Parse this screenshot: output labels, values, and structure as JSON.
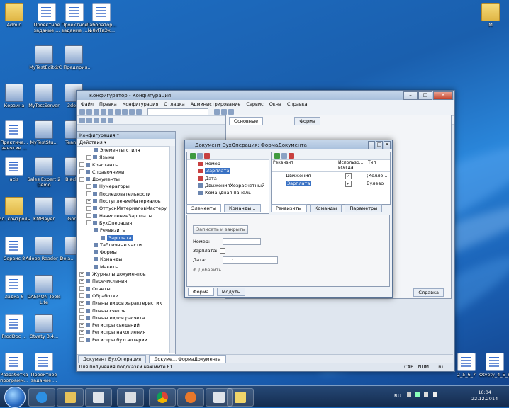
{
  "desktop": {
    "icons": [
      {
        "label": "Admin",
        "kind": "folder"
      },
      {
        "label": "Проектное задание ...",
        "kind": "doc"
      },
      {
        "label": "Проектное задание ...",
        "kind": "doc"
      },
      {
        "label": "Лаборатор... №8ИТвЭк...",
        "kind": "doc"
      },
      {
        "label": "MyTestEditor",
        "kind": "app"
      },
      {
        "label": "1С Предприя...",
        "kind": "app"
      },
      {
        "label": "Корзина",
        "kind": "app"
      },
      {
        "label": "MyTestServer",
        "kind": "app"
      },
      {
        "label": "3do...",
        "kind": "app"
      },
      {
        "label": "Практиче... занятие ...",
        "kind": "doc"
      },
      {
        "label": "MyTestStu...",
        "kind": "app"
      },
      {
        "label": "Team...",
        "kind": "app"
      },
      {
        "label": "acis",
        "kind": "doc"
      },
      {
        "label": "Sales Expert 2 Demo",
        "kind": "app"
      },
      {
        "label": "Black...",
        "kind": "app"
      },
      {
        "label": "Эл. контроль",
        "kind": "folder"
      },
      {
        "label": "KMPlayer",
        "kind": "app"
      },
      {
        "label": "Gor...",
        "kind": "app"
      },
      {
        "label": "Сервис 8",
        "kind": "doc"
      },
      {
        "label": "Adobe Reader 9",
        "kind": "app"
      },
      {
        "label": "Dela... Tools",
        "kind": "app"
      },
      {
        "label": "ладка 6",
        "kind": "doc"
      },
      {
        "label": "DAEMON Tools Lite",
        "kind": "app"
      },
      {
        "label": "ProdDoc ...",
        "kind": "doc"
      },
      {
        "label": "Otvety 3,4...",
        "kind": "app"
      },
      {
        "label": "Разработка программ...",
        "kind": "doc"
      },
      {
        "label": "Проектное задание ...",
        "kind": "doc"
      },
      {
        "label": "М",
        "kind": "folder"
      },
      {
        "label": "2_5_6_7",
        "kind": "doc"
      },
      {
        "label": "Otvety_4_5_6",
        "kind": "doc"
      }
    ]
  },
  "configurator": {
    "title": "Конфигуратор - Конфигурация",
    "menu": [
      "Файл",
      "Правка",
      "Конфигурация",
      "Отладка",
      "Администрирование",
      "Сервис",
      "Окна",
      "Справка"
    ],
    "tree_panel": {
      "title": "Конфигурация *",
      "actions_label": "Действия ▾",
      "items": [
        {
          "label": "Элементы стиля",
          "indent": 2
        },
        {
          "label": "Языки",
          "indent": 1
        },
        {
          "label": "Константы",
          "indent": 0
        },
        {
          "label": "Справочники",
          "indent": 0
        },
        {
          "label": "Документы",
          "indent": 0
        },
        {
          "label": "Нумераторы",
          "indent": 1
        },
        {
          "label": "Последовательности",
          "indent": 1
        },
        {
          "label": "ПоступлениеМатериалов",
          "indent": 1
        },
        {
          "label": "ОтпускМатериаловМастеру",
          "indent": 1
        },
        {
          "label": "НачислениеЗарплаты",
          "indent": 1
        },
        {
          "label": "БухОперация",
          "indent": 1
        },
        {
          "label": "Реквизиты",
          "indent": 2
        },
        {
          "label": "Зарплата",
          "indent": 3,
          "selected": true
        },
        {
          "label": "Табличные части",
          "indent": 2
        },
        {
          "label": "Формы",
          "indent": 2
        },
        {
          "label": "Команды",
          "indent": 2
        },
        {
          "label": "Макеты",
          "indent": 2
        },
        {
          "label": "Журналы документов",
          "indent": 0
        },
        {
          "label": "Перечисления",
          "indent": 0
        },
        {
          "label": "Отчеты",
          "indent": 0
        },
        {
          "label": "Обработки",
          "indent": 0
        },
        {
          "label": "Планы видов характеристик",
          "indent": 0
        },
        {
          "label": "Планы счетов",
          "indent": 0
        },
        {
          "label": "Планы видов расчета",
          "indent": 0
        },
        {
          "label": "Регистры сведений",
          "indent": 0
        },
        {
          "label": "Регистры накопления",
          "indent": 0
        },
        {
          "label": "Регистры бухгалтерии",
          "indent": 0
        }
      ]
    },
    "bg_tabs": [
      "Основные",
      "Форма"
    ],
    "bg_help": "Справка",
    "window_tabs": [
      "Документ БухОперация",
      "Докуме... ФормаДокумента"
    ],
    "status_text": "Для получения подсказки нажмите F1",
    "status_cap": "CAP",
    "status_num": "NUM",
    "status_lang": "ru"
  },
  "form_window": {
    "title": "Документ БухОперация: ФормаДокумента",
    "elements": [
      {
        "label": "Номер"
      },
      {
        "label": "Зарплата",
        "selected": true
      },
      {
        "label": "Дата"
      },
      {
        "label": "ДвиженияХозрасчетный"
      },
      {
        "label": "Командная панель"
      }
    ],
    "left_tabs": [
      "Элементы",
      "Команды..."
    ],
    "attr_headers": {
      "col1": "Реквизит",
      "col2": "Использо... всегда",
      "col3": "Тип"
    },
    "attr_rows": [
      {
        "name": "Движения",
        "type": "(Колле..."
      },
      {
        "name": "Зарплата",
        "type": "Булево",
        "selected": true
      }
    ],
    "right_tabs": [
      "Реквизиты",
      "Команды",
      "Параметры"
    ],
    "preview": {
      "button": "Записать и закрыть",
      "fields": [
        "Номер:",
        "Зарплата:",
        "Дата:"
      ],
      "date_mask": ". .   : :",
      "add_label": "Добавить"
    },
    "bottom_tabs": [
      "Форма",
      "Модуль"
    ]
  },
  "taskbar": {
    "lang": "RU",
    "time": "16:04",
    "date": "22.12.2014"
  }
}
